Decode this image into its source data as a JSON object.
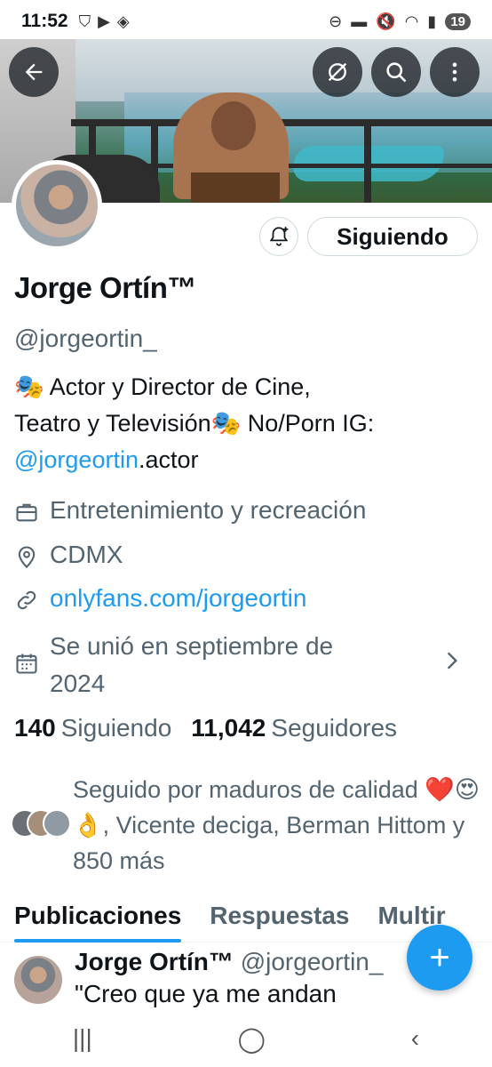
{
  "status_bar": {
    "time": "11:52",
    "battery": "19"
  },
  "banner": {
    "back_icon": "arrow-left-icon",
    "icons": [
      "no-filter-icon",
      "search-icon",
      "more-vertical-icon"
    ]
  },
  "profile": {
    "follow_button": "Siguiendo",
    "name": "Jorge Ortín™",
    "handle": "@jorgeortin_",
    "bio_line1": "🎭 Actor y Director de Cine,",
    "bio_line2": "Teatro y Televisión🎭 No/Porn IG:",
    "bio_link": "@jorgeortin",
    "bio_link_suffix": ".actor",
    "category": "Entretenimiento y recreación",
    "location": "CDMX",
    "website": "onlyfans.com/jorgeortin",
    "joined_line1": "Se unió en septiembre de",
    "joined_line2": "2024",
    "following_count": "140",
    "following_label": "Siguiendo",
    "followers_count": "11,042",
    "followers_label": "Seguidores",
    "followed_by": "Seguido por maduros de calidad ❤️😍👌, Vicente deciga, Berman Hittom y 850 más"
  },
  "tabs": [
    "Publicaciones",
    "Respuestas",
    "Multir"
  ],
  "post": {
    "author": "Jorge Ortín™",
    "handle": "@jorgeortin_",
    "text": "\"Creo que ya me andan"
  },
  "fab_label": "+",
  "nav": {
    "recents": "|||",
    "home": "◯",
    "back": "‹"
  },
  "colors": {
    "accent": "#1d9bf0",
    "text": "#0f1419",
    "secondary": "#536471"
  }
}
